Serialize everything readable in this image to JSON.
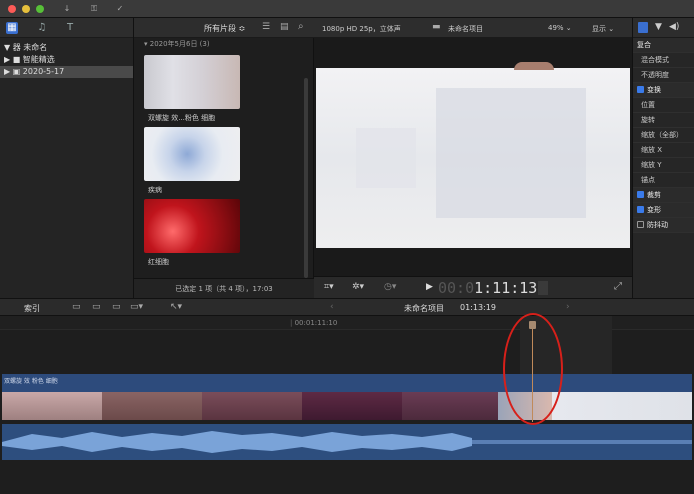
{
  "window": {
    "toolbar_icons": [
      "down-arrow-icon",
      "key-icon",
      "check-circle-icon"
    ]
  },
  "library": {
    "items": [
      {
        "label": "▼ 器 未命名",
        "selected": false
      },
      {
        "label": "▶ ■ 智能精选",
        "selected": false
      },
      {
        "label": "▶ ▣ 2020-5-17",
        "selected": true
      }
    ]
  },
  "browser": {
    "filter": "所有片段 ≎",
    "date_header": "▾ 2020年5月6日  (3)",
    "clips": [
      {
        "label": "双螺旋 效...粉色 细胞"
      },
      {
        "label": "疾病"
      },
      {
        "label": "红细胞"
      }
    ],
    "status": "已选定 1 项（共 4 项），17:03"
  },
  "viewer": {
    "format": "1080p HD 25p，立体声",
    "project_name": "未命名项目",
    "zoom": "49% ⌄",
    "display_menu": "显示 ⌄",
    "timecode_dim": "00:0",
    "timecode_bright": "1:11:13"
  },
  "inspector": {
    "rows": [
      {
        "label": "复合",
        "type": "hdr-plain"
      },
      {
        "label": "混合模式",
        "type": "item"
      },
      {
        "label": "不透明度",
        "type": "item"
      },
      {
        "label": "变换",
        "type": "hdr-on"
      },
      {
        "label": "位置",
        "type": "item"
      },
      {
        "label": "旋转",
        "type": "item"
      },
      {
        "label": "缩放（全部）",
        "type": "item"
      },
      {
        "label": "缩放 X",
        "type": "item"
      },
      {
        "label": "缩放 Y",
        "type": "item"
      },
      {
        "label": "锚点",
        "type": "item"
      },
      {
        "label": "裁剪",
        "type": "hdr-on"
      },
      {
        "label": "变形",
        "type": "hdr-on"
      },
      {
        "label": "防抖动",
        "type": "hdr-off"
      }
    ]
  },
  "timeline": {
    "index_label": "索引",
    "project_label": "未命名项目",
    "duration": "01:13:19",
    "ruler_time": "00:01:11:10",
    "clip_title": "双螺旋 效 粉色 细胞"
  }
}
